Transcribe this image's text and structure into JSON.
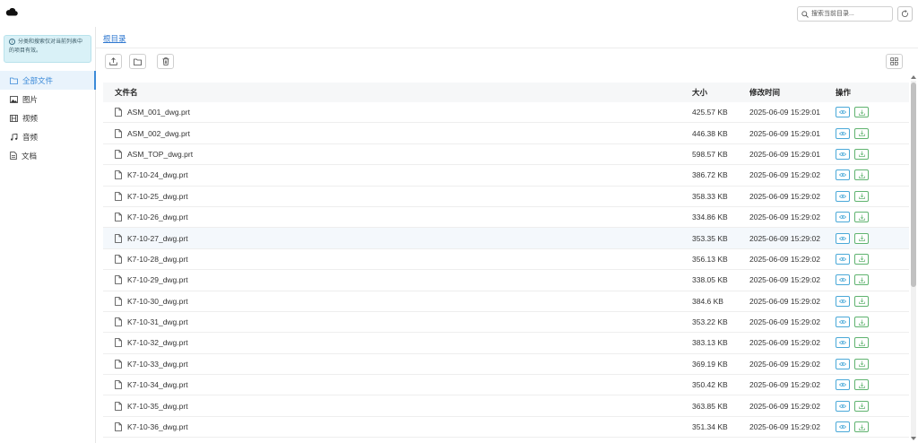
{
  "header": {
    "logo_icon": "cloud-icon",
    "search_placeholder": "搜索当前目录...",
    "refresh_icon": "refresh-icon"
  },
  "sidebar": {
    "notice": "分类和搜索仅对当前列表中的项目有效。",
    "items": [
      {
        "label": "全部文件",
        "icon": "folder-icon",
        "active": true
      },
      {
        "label": "图片",
        "icon": "image-icon",
        "active": false
      },
      {
        "label": "视频",
        "icon": "film-icon",
        "active": false
      },
      {
        "label": "音频",
        "icon": "music-icon",
        "active": false
      },
      {
        "label": "文档",
        "icon": "document-icon",
        "active": false
      }
    ]
  },
  "breadcrumb": {
    "root": "根目录"
  },
  "toolbar": {
    "upload_icon": "upload-icon",
    "new_folder_icon": "new-folder-icon",
    "delete_icon": "trash-icon",
    "grid_view_icon": "grid-view-icon"
  },
  "table": {
    "headers": {
      "name": "文件名",
      "size": "大小",
      "modified": "修改时间",
      "actions": "操作"
    },
    "rows": [
      {
        "name": "ASM_001_dwg.prt",
        "size": "425.57 KB",
        "modified": "2025-06-09 15:29:01"
      },
      {
        "name": "ASM_002_dwg.prt",
        "size": "446.38 KB",
        "modified": "2025-06-09 15:29:01"
      },
      {
        "name": "ASM_TOP_dwg.prt",
        "size": "598.57 KB",
        "modified": "2025-06-09 15:29:01"
      },
      {
        "name": "K7-10-24_dwg.prt",
        "size": "386.72 KB",
        "modified": "2025-06-09 15:29:02"
      },
      {
        "name": "K7-10-25_dwg.prt",
        "size": "358.33 KB",
        "modified": "2025-06-09 15:29:02"
      },
      {
        "name": "K7-10-26_dwg.prt",
        "size": "334.86 KB",
        "modified": "2025-06-09 15:29:02"
      },
      {
        "name": "K7-10-27_dwg.prt",
        "size": "353.35 KB",
        "modified": "2025-06-09 15:29:02"
      },
      {
        "name": "K7-10-28_dwg.prt",
        "size": "356.13 KB",
        "modified": "2025-06-09 15:29:02"
      },
      {
        "name": "K7-10-29_dwg.prt",
        "size": "338.05 KB",
        "modified": "2025-06-09 15:29:02"
      },
      {
        "name": "K7-10-30_dwg.prt",
        "size": "384.6 KB",
        "modified": "2025-06-09 15:29:02"
      },
      {
        "name": "K7-10-31_dwg.prt",
        "size": "353.22 KB",
        "modified": "2025-06-09 15:29:02"
      },
      {
        "name": "K7-10-32_dwg.prt",
        "size": "383.13 KB",
        "modified": "2025-06-09 15:29:02"
      },
      {
        "name": "K7-10-33_dwg.prt",
        "size": "369.19 KB",
        "modified": "2025-06-09 15:29:02"
      },
      {
        "name": "K7-10-34_dwg.prt",
        "size": "350.42 KB",
        "modified": "2025-06-09 15:29:02"
      },
      {
        "name": "K7-10-35_dwg.prt",
        "size": "363.85 KB",
        "modified": "2025-06-09 15:29:02"
      },
      {
        "name": "K7-10-36_dwg.prt",
        "size": "351.34 KB",
        "modified": "2025-06-09 15:29:02"
      }
    ],
    "highlighted_row": 6,
    "row_icon": "file-icon",
    "view_icon": "eye-icon",
    "download_icon": "download-icon"
  },
  "colors": {
    "accent": "#3b8ad8",
    "notice_bg": "#d9f1f7",
    "view_btn": "#4aa9d8",
    "download_btn": "#5fb36f"
  }
}
